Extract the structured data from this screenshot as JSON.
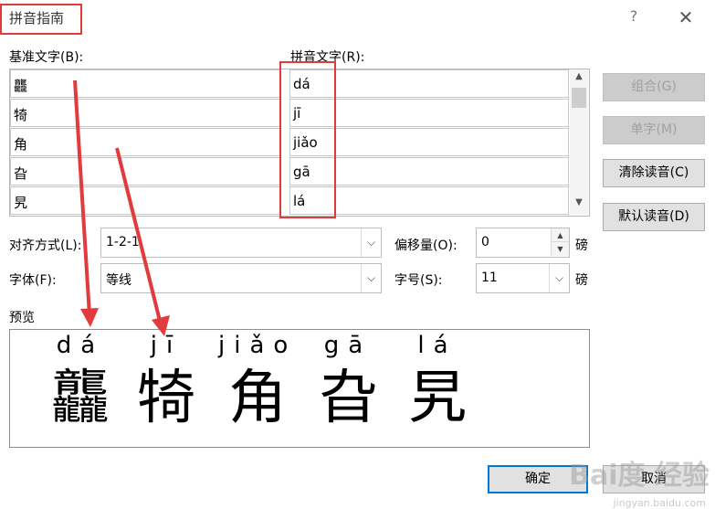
{
  "window": {
    "title": "拼音指南",
    "help_glyph": "?",
    "close_glyph": "✕"
  },
  "labels": {
    "base_text": "基准文字(B):",
    "pinyin_text": "拼音文字(R):",
    "alignment": "对齐方式(L):",
    "offset": "偏移量(O):",
    "font": "字体(F):",
    "size": "字号(S):",
    "preview": "预览",
    "unit_offset": "磅",
    "unit_size": "磅"
  },
  "rows": [
    {
      "base": "龘",
      "pinyin": "dá"
    },
    {
      "base": "犄",
      "pinyin": "jī"
    },
    {
      "base": "角",
      "pinyin": "jiǎo"
    },
    {
      "base": "旮",
      "pinyin": "gā"
    },
    {
      "base": "旯",
      "pinyin": "lá"
    }
  ],
  "buttons": {
    "group": "组合(G)",
    "single": "单字(M)",
    "clear": "清除读音(C)",
    "default": "默认读音(D)",
    "ok": "确定",
    "cancel": "取消"
  },
  "fields": {
    "alignment_value": "1-2-1",
    "offset_value": "0",
    "font_value": "等线",
    "size_value": "11"
  },
  "preview_items": [
    {
      "pinyin": "dá",
      "char": "龘"
    },
    {
      "pinyin": "jī",
      "char": "犄"
    },
    {
      "pinyin": "jiǎo",
      "char": "角"
    },
    {
      "pinyin": "gā",
      "char": "旮"
    },
    {
      "pinyin": "lá",
      "char": "旯"
    }
  ],
  "watermark": {
    "main": "Bai度 经验",
    "sub": "jingyan.baidu.com"
  },
  "colors": {
    "annotation_red": "#e23b3b",
    "button_face": "#e1e1e1",
    "disabled_text": "#a0a0a0",
    "ok_border": "#0078d7"
  }
}
